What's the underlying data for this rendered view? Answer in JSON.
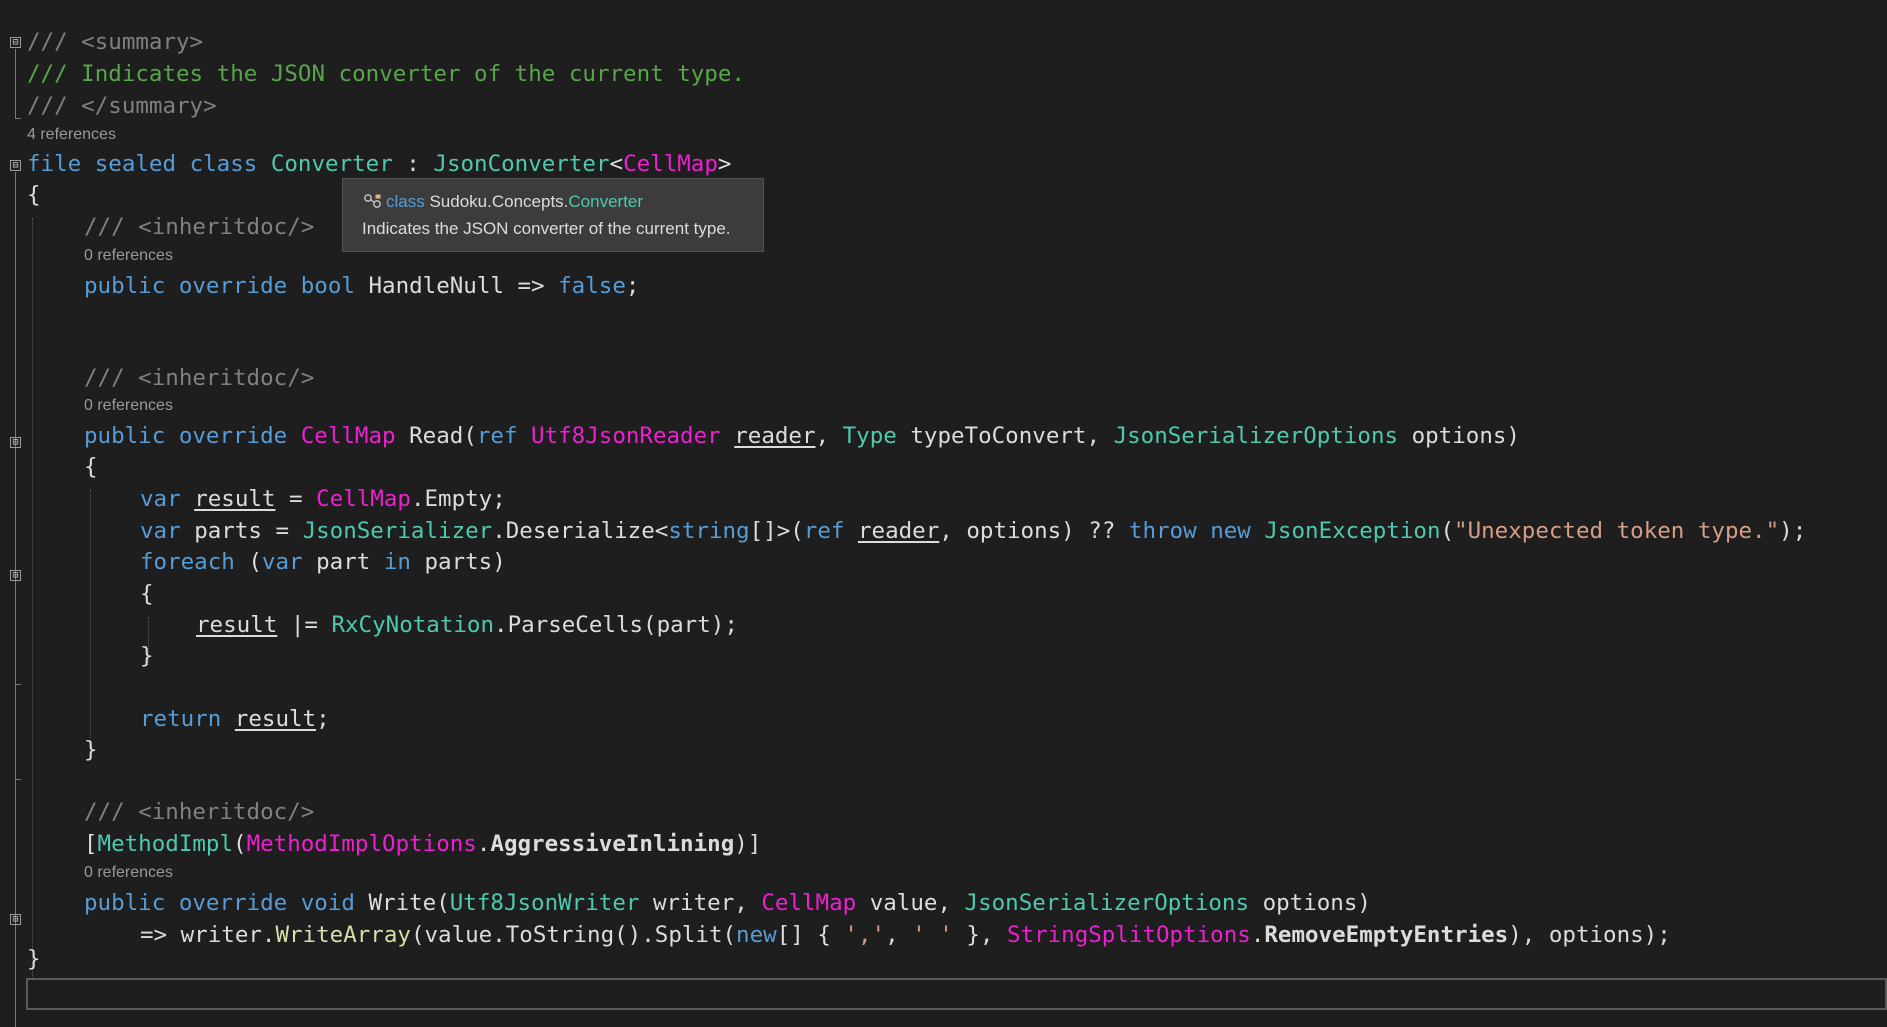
{
  "editor": {
    "lines": {
      "l1": "/// <summary>",
      "l2": "/// Indicates the JSON converter of the current type.",
      "l3": "/// </summary>",
      "l4_kw1": "file",
      "l4_kw2": "sealed",
      "l4_kw3": "class",
      "l4_name": "Converter",
      "l4_colon": " : ",
      "l4_base": "JsonConverter",
      "l4_lt": "<",
      "l4_arg": "CellMap",
      "l4_gt": ">",
      "open_brace": "{",
      "inheritdoc": "/// <inheritdoc/>",
      "p_public": "public",
      "p_override": "override",
      "p_bool": "bool",
      "p_name": "HandleNull",
      "p_arrow": " => ",
      "p_false": "false",
      "semicolon": ";",
      "r_type": "CellMap",
      "r_name": "Read",
      "r_paren": "(",
      "r_ref": "ref",
      "r_readertype": "Utf8JsonReader",
      "r_reader": "reader",
      "r_comma": ", ",
      "r_typetype": "Type",
      "r_typename": "typeToConvert",
      "r_opttype": "JsonSerializerOptions",
      "r_optname": "options",
      "r_close": ")",
      "b_var": "var",
      "b_result": "result",
      "b_eq": " = ",
      "b_cellmap": "CellMap",
      "b_empty": ".Empty;",
      "b_parts": "parts",
      "b_ser": "JsonSerializer",
      "b_deser": ".Deserialize<",
      "b_string": "string",
      "b_arr": "[]>(",
      "b_reader2": "reader",
      "b_opts": ", options) ?? ",
      "b_throw": "throw",
      "b_new": "new",
      "b_exc": "JsonException",
      "b_excopen": "(",
      "b_msg": "\"Unexpected token type.\"",
      "b_excclose": ");",
      "f_foreach": "foreach",
      "f_open": " (",
      "f_part": " part ",
      "f_in": "in",
      "f_parts": " parts)",
      "inner_open": "{",
      "i_result": "result",
      "i_op": " |= ",
      "i_rxcy": "RxCyNotation",
      "i_call": ".ParseCells(part);",
      "inner_close": "}",
      "ret_kw": "return",
      "ret_val": "result",
      "method_close": "}",
      "attr_open": "[",
      "attr_name": "MethodImpl",
      "attr_paren": "(",
      "attr_enum": "MethodImplOptions",
      "attr_dot": ".",
      "attr_member": "AggressiveInlining",
      "attr_close": ")]",
      "w_void": "void",
      "w_name": "Write",
      "w_paren": "(",
      "w_writertype": "Utf8JsonWriter",
      "w_writer": " writer, ",
      "w_cellmap": "CellMap",
      "w_value": " value, ",
      "w_opttype": "JsonSerializerOptions",
      "w_opts": " options)",
      "e_arrow": "=> writer.",
      "e_writearray": "WriteArray",
      "e_tostring": "(value.ToString().Split(",
      "e_new": "new",
      "e_arr": "[] { ",
      "e_comma_lit": "','",
      "e_sep": ", ",
      "e_space_lit": "' '",
      "e_closebrace": " }, ",
      "e_enum": "StringSplitOptions",
      "e_dot": ".",
      "e_member": "RemoveEmptyEntries",
      "e_end": "), options);",
      "close_brace": "}"
    },
    "codelens": {
      "class_refs": "4 references",
      "handlenull_refs": "0 references",
      "read_refs": "0 references",
      "write_refs": "0 references"
    },
    "fold_glyph": "⊟"
  },
  "tooltip": {
    "icon": "class-icon",
    "keyword": "class",
    "namespace": "Sudoku.Concepts.",
    "name": "Converter",
    "description": "Indicates the JSON converter of the current type."
  },
  "colors": {
    "background": "#1e1e1e",
    "keyword": "#569cd6",
    "type": "#4ec9b0",
    "struct": "#ec20d0",
    "comment": "#57a64a",
    "string": "#d69d85"
  }
}
